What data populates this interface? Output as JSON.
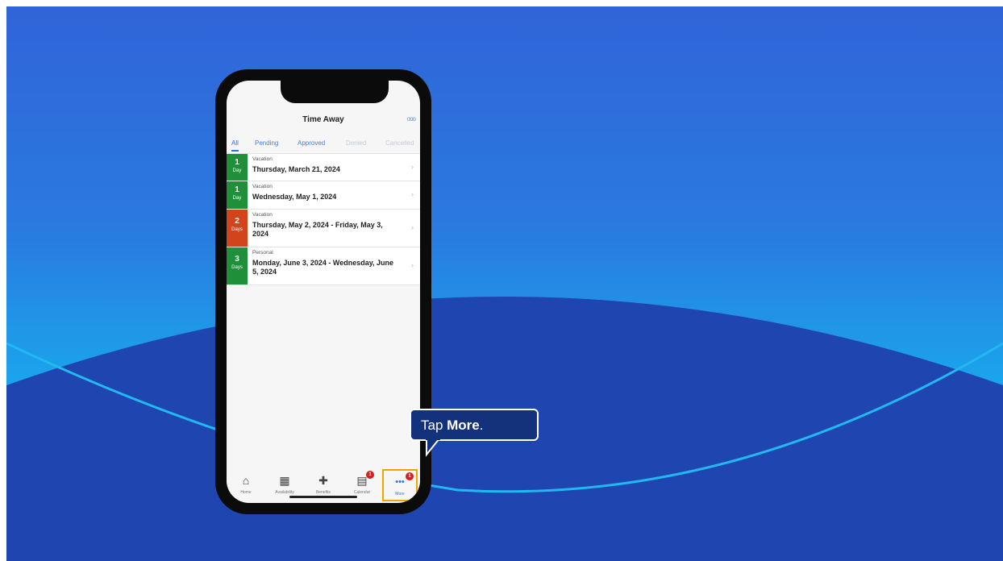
{
  "app": {
    "title": "Time Away",
    "overflow_icon": "ooo"
  },
  "tabs": [
    {
      "label": "All",
      "state": "active"
    },
    {
      "label": "Pending",
      "state": "enabled"
    },
    {
      "label": "Approved",
      "state": "enabled"
    },
    {
      "label": "Denied",
      "state": "muted"
    },
    {
      "label": "Cancelled",
      "state": "muted"
    }
  ],
  "requests": [
    {
      "days": "1",
      "unit": "Day",
      "type": "Vacation",
      "date": "Thursday, March 21, 2024",
      "color": "#1f8f3a"
    },
    {
      "days": "1",
      "unit": "Day",
      "type": "Vacation",
      "date": "Wednesday, May 1, 2024",
      "color": "#1f8f3a"
    },
    {
      "days": "2",
      "unit": "Days",
      "type": "Vacation",
      "date": "Thursday, May 2, 2024 - Friday, May 3, 2024",
      "color": "#d2451c"
    },
    {
      "days": "3",
      "unit": "Days",
      "type": "Personal",
      "date": "Monday, June 3, 2024 - Wednesday, June 5, 2024",
      "color": "#1f8f3a"
    }
  ],
  "tabbar": [
    {
      "label": "Home",
      "icon": "home-icon",
      "glyph": "⌂"
    },
    {
      "label": "Availability",
      "icon": "availability-icon",
      "glyph": "▦"
    },
    {
      "label": "Benefits",
      "icon": "benefits-icon",
      "glyph": "✚"
    },
    {
      "label": "Calendar",
      "icon": "calendar-icon",
      "glyph": "▤",
      "badge": "1"
    },
    {
      "label": "More",
      "icon": "more-icon",
      "glyph": "•••",
      "badge": "1"
    }
  ],
  "callout": {
    "prefix": "Tap ",
    "bold": "More",
    "suffix": "."
  },
  "colors": {
    "approved": "#1f8f3a",
    "pending": "#d2451c",
    "highlight": "#f0a500",
    "callout_bg": "#14327b"
  }
}
